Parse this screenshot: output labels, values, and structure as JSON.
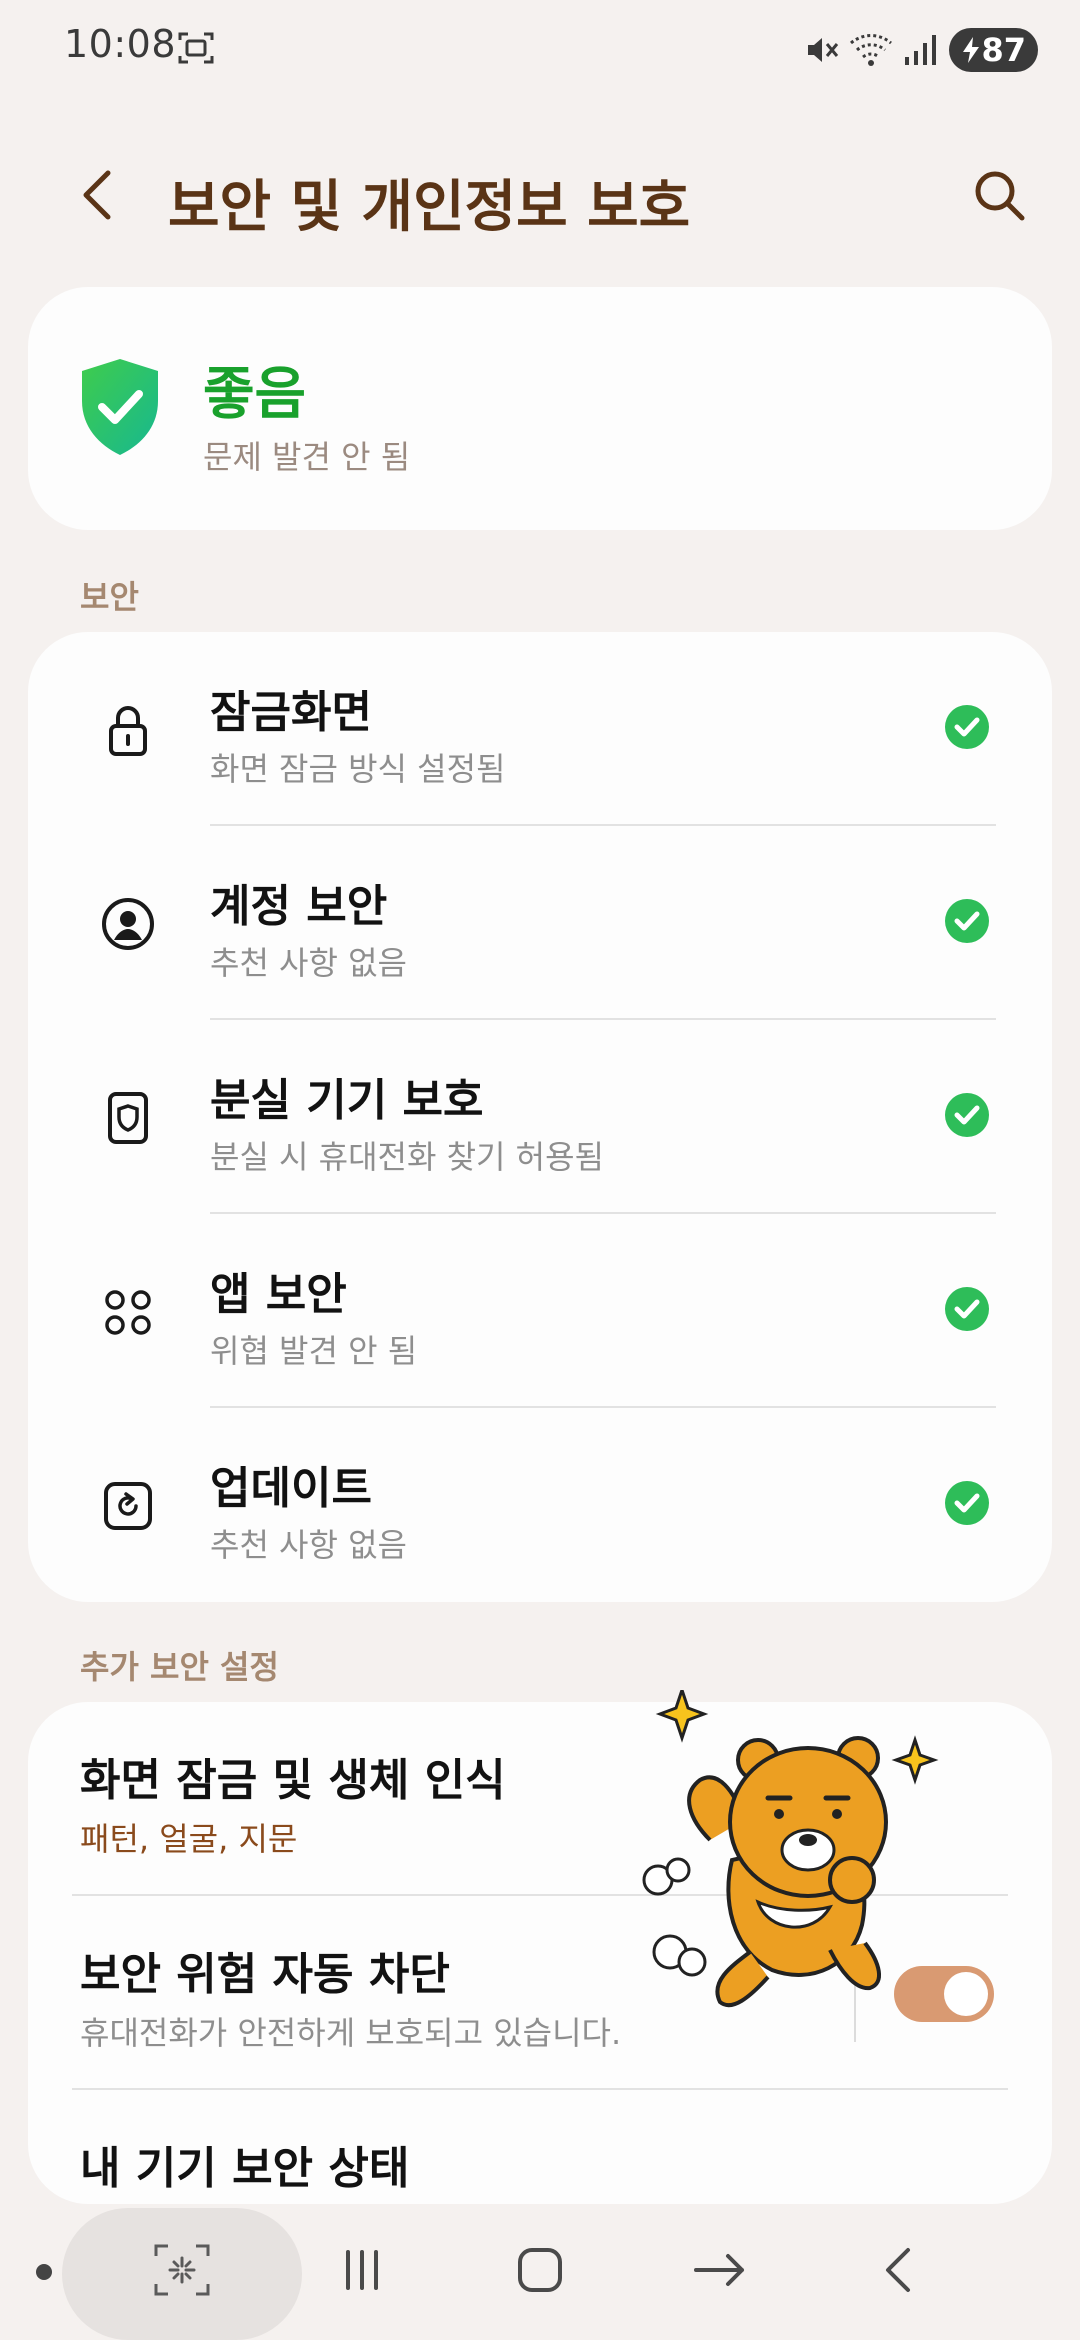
{
  "status_bar": {
    "time": "10:08",
    "battery": "87"
  },
  "header": {
    "title": "보안 및 개인정보 보호"
  },
  "status_card": {
    "title": "좋음",
    "subtitle": "문제 발견 안 됨"
  },
  "sections": {
    "security": "보안",
    "extra": "추가 보안 설정"
  },
  "security_items": [
    {
      "title": "잠금화면",
      "subtitle": "화면 잠금 방식 설정됨",
      "icon": "lock-icon"
    },
    {
      "title": "계정 보안",
      "subtitle": "추천 사항 없음",
      "icon": "account-icon"
    },
    {
      "title": "분실 기기 보호",
      "subtitle": "분실 시 휴대전화 찾기 허용됨",
      "icon": "device-shield-icon"
    },
    {
      "title": "앱 보안",
      "subtitle": "위협 발견 안 됨",
      "icon": "apps-icon"
    },
    {
      "title": "업데이트",
      "subtitle": "추천 사항 없음",
      "icon": "update-icon"
    }
  ],
  "extra_items": [
    {
      "title": "화면 잠금 및 생체 인식",
      "subtitle": "패턴, 얼굴, 지문"
    },
    {
      "title": "보안 위험 자동 차단",
      "subtitle": "휴대전화가 안전하게 보호되고 있습니다.",
      "toggle_on": true
    },
    {
      "title": "내 기기 보안 상태"
    }
  ],
  "colors": {
    "accent": "#5a3416",
    "good": "#19a12c",
    "check": "#2ebd59",
    "toggle": "#d99a72"
  }
}
